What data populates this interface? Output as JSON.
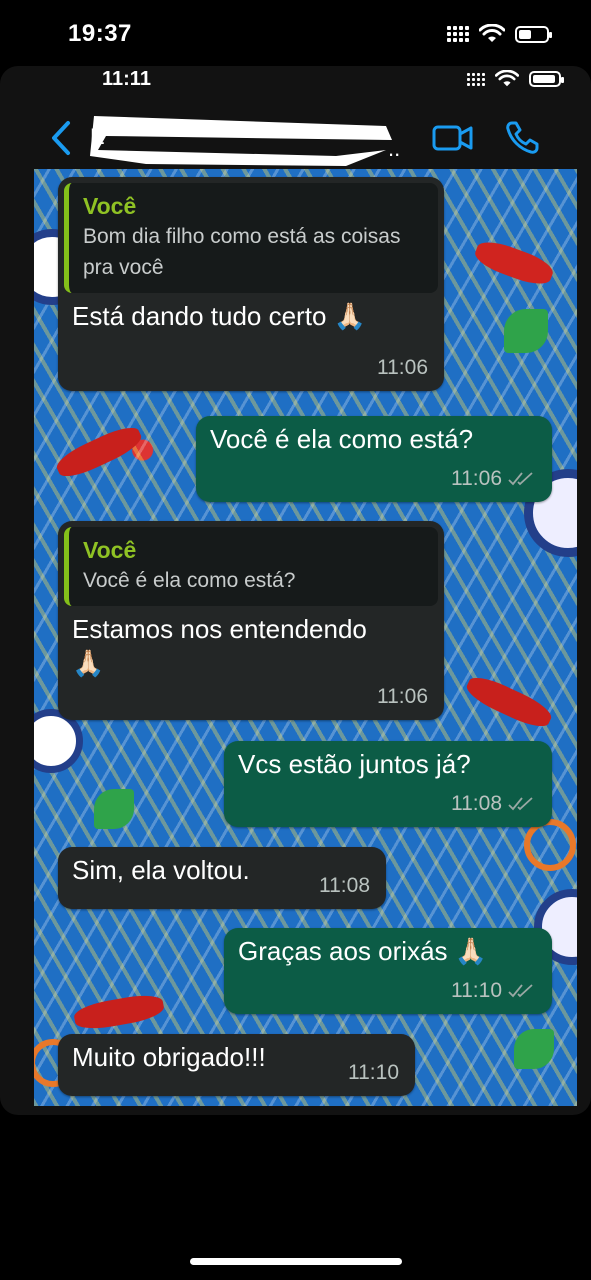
{
  "outer_status": {
    "time": "19:37"
  },
  "inner_status": {
    "time": "11:11"
  },
  "header": {
    "contact_name": "E",
    "back_icon": "chevron-left-icon",
    "video_icon": "video-camera-icon",
    "call_icon": "phone-icon",
    "accent_color": "#1a9bf0"
  },
  "messages": [
    {
      "direction": "incoming",
      "quote_author": "Você",
      "quote_text": "Bom dia filho como está as coisas pra você",
      "text": "Está dando tudo certo 🙏🏻",
      "time": "11:06"
    },
    {
      "direction": "outgoing",
      "text": "Você é ela como está?",
      "time": "11:06",
      "status": "read"
    },
    {
      "direction": "incoming",
      "quote_author": "Você",
      "quote_text": "Você é ela como está?",
      "text": "Estamos nos entendendo 🙏🏻",
      "time": "11:06"
    },
    {
      "direction": "outgoing",
      "text": "Vcs estão juntos já?",
      "time": "11:08",
      "status": "read"
    },
    {
      "direction": "incoming",
      "text": "Sim, ela voltou.",
      "time": "11:08"
    },
    {
      "direction": "outgoing",
      "text": "Graças aos orixás 🙏🏻",
      "time": "11:10",
      "status": "read"
    },
    {
      "direction": "incoming",
      "text": "Muito obrigado!!!",
      "time": "11:10"
    }
  ],
  "colors": {
    "incoming_bubble": "#232626",
    "outgoing_bubble": "#0c5c46",
    "quote_bar": "#84c01a",
    "wallpaper_base": "#1f6fc4"
  }
}
